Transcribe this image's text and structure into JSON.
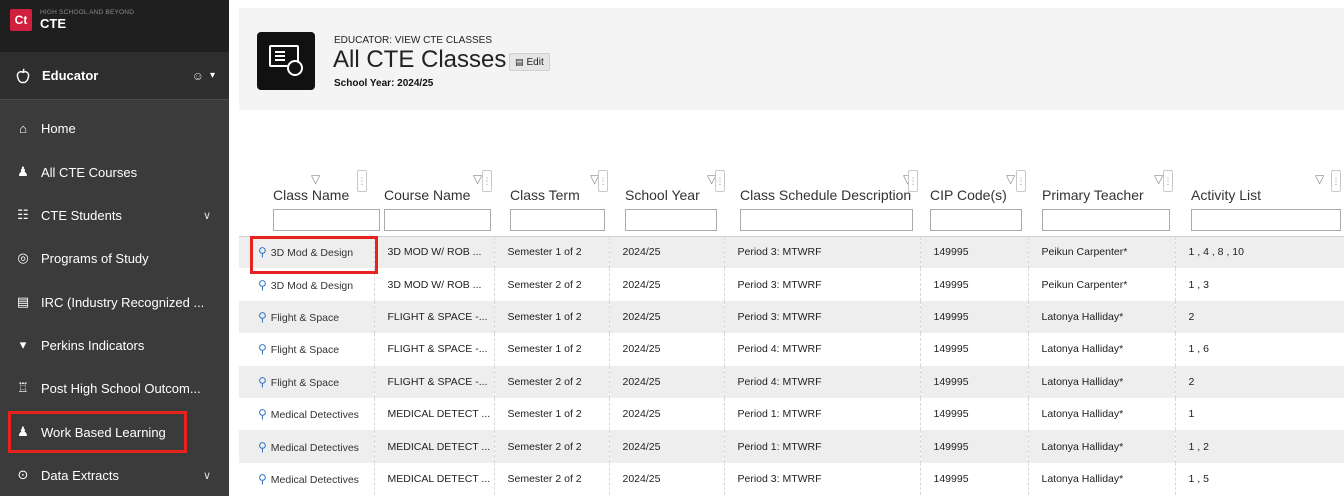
{
  "brand": {
    "logo": "Ct",
    "subtitle": "HIGH SCHOOL AND BEYOND",
    "title": "CTE"
  },
  "role": {
    "label": "Educator",
    "icon": "apple-icon",
    "extra": "☺",
    "caret": "▾"
  },
  "sidebar": {
    "items": [
      {
        "label": "Home",
        "icon": "home-icon",
        "glyph": "⌂"
      },
      {
        "label": "All CTE Courses",
        "icon": "teacher-icon",
        "glyph": "♟"
      },
      {
        "label": "CTE Students",
        "icon": "students-icon",
        "glyph": "☷",
        "chevron": "∨"
      },
      {
        "label": "Programs of Study",
        "icon": "study-icon",
        "glyph": "◎"
      },
      {
        "label": "IRC (Industry Recognized ...",
        "icon": "certificate-icon",
        "glyph": "▤"
      },
      {
        "label": "Perkins Indicators",
        "icon": "caret-down-icon",
        "glyph": "▾"
      },
      {
        "label": "Post High School Outcom...",
        "icon": "graduation-cap-icon",
        "glyph": "♖"
      },
      {
        "label": "Work Based Learning",
        "icon": "work-icon",
        "glyph": "♟"
      },
      {
        "label": "Data Extracts",
        "icon": "data-extract-icon",
        "glyph": "⊙",
        "chevron": "∨"
      }
    ]
  },
  "header": {
    "breadcrumb": "EDUCATOR: VIEW CTE CLASSES",
    "title": "All CTE Classes",
    "edit_label": "Edit",
    "school_year": "School Year: 2024/25"
  },
  "table": {
    "columns": [
      "Class Name",
      "Course Name",
      "Class Term",
      "School Year",
      "Class Schedule Description",
      "CIP Code(s)",
      "Primary Teacher",
      "Activity List"
    ],
    "rows": [
      [
        "3D Mod & Design",
        "3D MOD W/ ROB ...",
        "Semester 1 of 2",
        "2024/25",
        "Period 3: MTWRF",
        "149995",
        "Peikun Carpenter*",
        "1 , 4 , 8 , 10"
      ],
      [
        "3D Mod & Design",
        "3D MOD W/ ROB ...",
        "Semester 2 of 2",
        "2024/25",
        "Period 3: MTWRF",
        "149995",
        "Peikun Carpenter*",
        "1 , 3"
      ],
      [
        "Flight & Space",
        "FLIGHT & SPACE -...",
        "Semester 1 of 2",
        "2024/25",
        "Period 3: MTWRF",
        "149995",
        "Latonya Halliday*",
        "2"
      ],
      [
        "Flight & Space",
        "FLIGHT & SPACE -...",
        "Semester 1 of 2",
        "2024/25",
        "Period 4: MTWRF",
        "149995",
        "Latonya Halliday*",
        "1 , 6"
      ],
      [
        "Flight & Space",
        "FLIGHT & SPACE -...",
        "Semester 2 of 2",
        "2024/25",
        "Period 4: MTWRF",
        "149995",
        "Latonya Halliday*",
        "2"
      ],
      [
        "Medical Detectives",
        "MEDICAL DETECT ...",
        "Semester 1 of 2",
        "2024/25",
        "Period 1: MTWRF",
        "149995",
        "Latonya Halliday*",
        "1"
      ],
      [
        "Medical Detectives",
        "MEDICAL DETECT ...",
        "Semester 2 of 2",
        "2024/25",
        "Period 1: MTWRF",
        "149995",
        "Latonya Halliday*",
        "1 , 2"
      ],
      [
        "Medical Detectives",
        "MEDICAL DETECT ...",
        "Semester 2 of 2",
        "2024/25",
        "Period 3: MTWRF",
        "149995",
        "Latonya Halliday*",
        "1 , 5"
      ]
    ]
  },
  "colors": {
    "sidebar_bg": "#3b3b3b",
    "brand_bg": "#1f1f1f",
    "logo_red": "#d11f3e",
    "highlight_red": "#e8231f",
    "link_blue": "#3a78c8"
  }
}
